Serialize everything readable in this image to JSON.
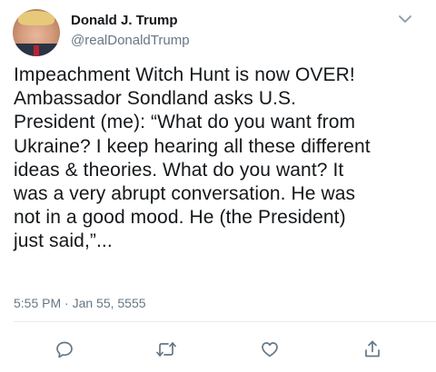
{
  "author": {
    "name": "Donald J. Trump",
    "handle": "@realDonaldTrump"
  },
  "tweet": {
    "text_lines": [
      "Impeachment Witch Hunt is now OVER!",
      "Ambassador Sondland asks U.S.",
      "President (me): “What do you want from",
      "Ukraine? I keep hearing all these different",
      "ideas & theories. What do you want? It",
      "was a very abrupt conversation. He was",
      "not in a good mood. He (the President)",
      "just said,”..."
    ],
    "timestamp": "5:55 PM · Jan 55, 5555"
  },
  "icons": {
    "menu": "chevron-down-icon",
    "reply": "reply-icon",
    "retweet": "retweet-icon",
    "like": "heart-icon",
    "share": "share-icon"
  },
  "colors": {
    "text": "#14171a",
    "secondary": "#657786",
    "icon": "#657786",
    "divider": "#e6ecf0"
  }
}
